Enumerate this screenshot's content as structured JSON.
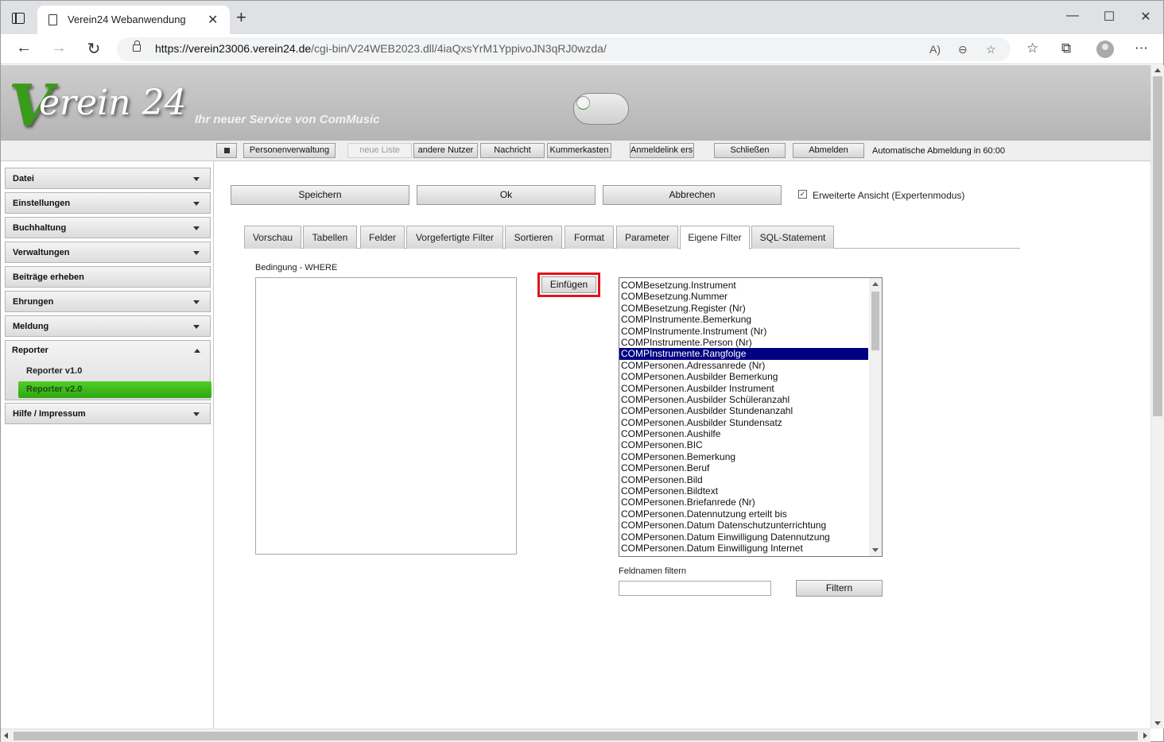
{
  "browser": {
    "tab_title": "Verein24 Webanwendung",
    "url_host": "https://verein23006.verein24.de",
    "url_path": "/cgi-bin/V24WEB2023.dll/4iaQxsYrM1YppivoJN3qRJ0wzda/"
  },
  "header": {
    "logo_initial": "V",
    "logo_text": "erein 24",
    "slogan": "Ihr neuer Service von ComMusic"
  },
  "topnav": {
    "personenverwaltung": "Personenverwaltung",
    "neue_liste": "neue Liste",
    "andere_nutzer": "andere Nutzer",
    "nachricht": "Nachricht",
    "kummerkasten": "Kummerkasten",
    "anmeldelink": "Anmeldelink erst",
    "schliessen": "Schließen",
    "abmelden": "Abmelden",
    "auto_logout": "Automatische Abmeldung in 60:00"
  },
  "sidebar": {
    "items": [
      {
        "label": "Datei"
      },
      {
        "label": "Einstellungen"
      },
      {
        "label": "Buchhaltung"
      },
      {
        "label": "Verwaltungen"
      },
      {
        "label": "Beiträge erheben"
      },
      {
        "label": "Ehrungen"
      },
      {
        "label": "Meldung"
      },
      {
        "label": "Reporter"
      },
      {
        "label": "Hilfe / Impressum"
      }
    ],
    "reporter_sub": [
      {
        "label": "Reporter v1.0"
      },
      {
        "label": "Reporter v2.0"
      }
    ],
    "active_color": "#3bb81a"
  },
  "actions": {
    "save": "Speichern",
    "ok": "Ok",
    "cancel": "Abbrechen",
    "expert_mode_label": "Erweiterte Ansicht (Expertenmodus)",
    "expert_mode_checked": true
  },
  "tabs": [
    {
      "label": "Vorschau"
    },
    {
      "label": "Tabellen"
    },
    {
      "label": "Felder"
    },
    {
      "label": "Vorgefertigte Filter"
    },
    {
      "label": "Sortieren"
    },
    {
      "label": "Format"
    },
    {
      "label": "Parameter"
    },
    {
      "label": "Eigene Filter"
    },
    {
      "label": "SQL-Statement"
    }
  ],
  "active_tab": "Eigene Filter",
  "filter": {
    "where_label": "Bedingung - WHERE",
    "where_value": "",
    "insert_button": "Einfügen",
    "highlight_color": "#e0141c",
    "fields": [
      "COMBesetzung.Instrument",
      "COMBesetzung.Nummer",
      "COMBesetzung.Register (Nr)",
      "COMPInstrumente.Bemerkung",
      "COMPInstrumente.Instrument (Nr)",
      "COMPInstrumente.Person (Nr)",
      "COMPInstrumente.Rangfolge",
      "COMPersonen.Adressanrede (Nr)",
      "COMPersonen.Ausbilder Bemerkung",
      "COMPersonen.Ausbilder Instrument",
      "COMPersonen.Ausbilder Schüleranzahl",
      "COMPersonen.Ausbilder Stundenanzahl",
      "COMPersonen.Ausbilder Stundensatz",
      "COMPersonen.Aushilfe",
      "COMPersonen.BIC",
      "COMPersonen.Bemerkung",
      "COMPersonen.Beruf",
      "COMPersonen.Bild",
      "COMPersonen.Bildtext",
      "COMPersonen.Briefanrede (Nr)",
      "COMPersonen.Datennutzung erteilt bis",
      "COMPersonen.Datum Datenschutzunterrichtung",
      "COMPersonen.Datum Einwilligung Datennutzung",
      "COMPersonen.Datum Einwilligung Internet"
    ],
    "selected_field": "COMPInstrumente.Rangfolge",
    "fieldname_filter_label": "Feldnamen filtern",
    "fieldname_filter_value": "",
    "filter_button": "Filtern"
  }
}
